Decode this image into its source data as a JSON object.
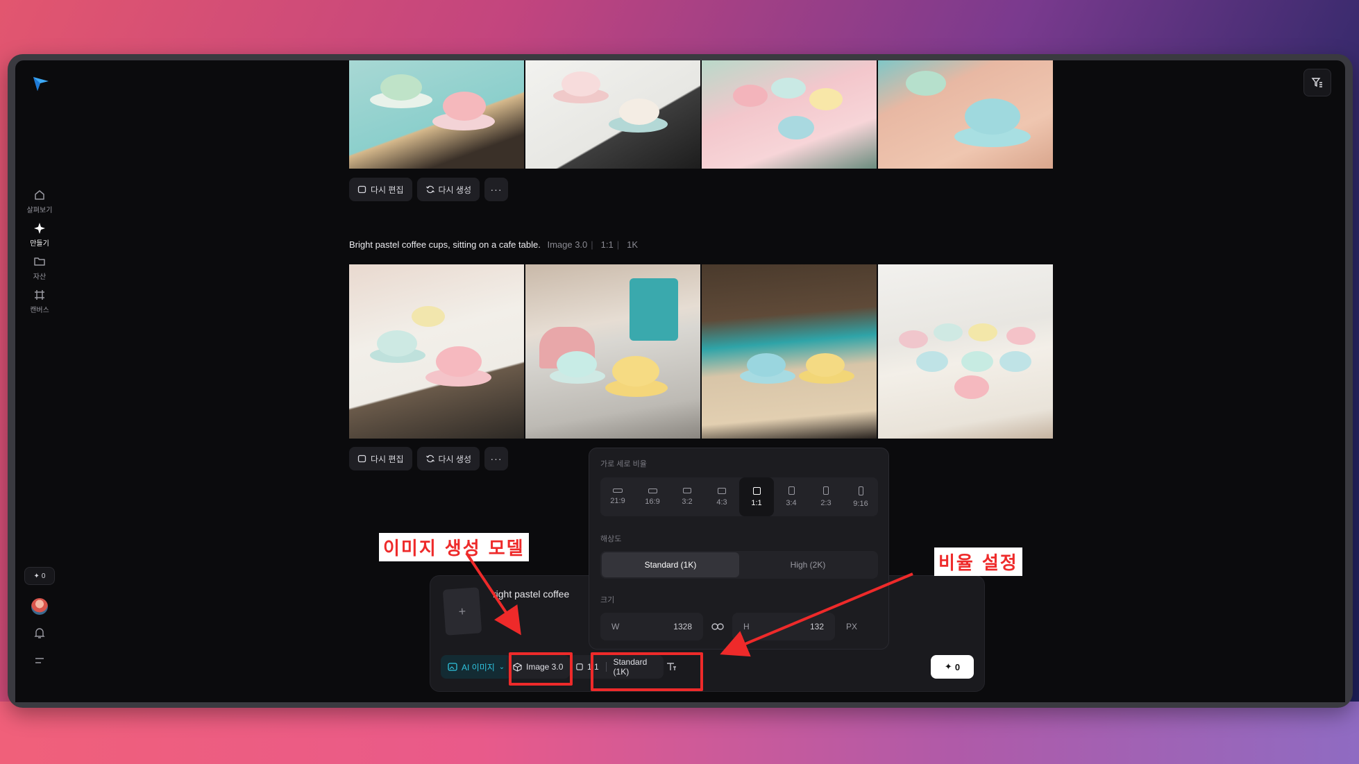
{
  "sidebar": {
    "items": [
      {
        "label": "살펴보기",
        "icon": "home-icon"
      },
      {
        "label": "만들기",
        "icon": "sparkle-icon"
      },
      {
        "label": "자산",
        "icon": "folder-icon"
      },
      {
        "label": "캔버스",
        "icon": "canvas-icon"
      }
    ],
    "credits": "0"
  },
  "gallery": {
    "actions": {
      "reedit": "다시 편집",
      "regenerate": "다시 생성",
      "more": "···"
    },
    "prompt": "Bright pastel coffee cups, sitting on a cafe table.",
    "meta": [
      "Image 3.0",
      "1:1",
      "1K"
    ]
  },
  "composer": {
    "prompt_text": "right pastel coffee",
    "ai_chip": "AI 이미지",
    "model_chip": "Image 3.0",
    "ratio_chip": "1:1",
    "resolution_chip": "Standard (1K)",
    "generate_cost": "0"
  },
  "popover": {
    "ratio_label": "가로 세로 비율",
    "ratios": [
      "21:9",
      "16:9",
      "3:2",
      "4:3",
      "1:1",
      "3:4",
      "2:3",
      "9:16"
    ],
    "selected_ratio": "1:1",
    "resolution_label": "해상도",
    "resolutions": [
      "Standard (1K)",
      "High (2K)"
    ],
    "size_label": "크기",
    "width_key": "W",
    "width_value": "1328",
    "height_key": "H",
    "height_value": "132",
    "unit": "PX"
  },
  "annotations": {
    "model_callout": "이미지 생성 모델",
    "ratio_callout": "비율 설정",
    "color": "#ee2a2a"
  }
}
